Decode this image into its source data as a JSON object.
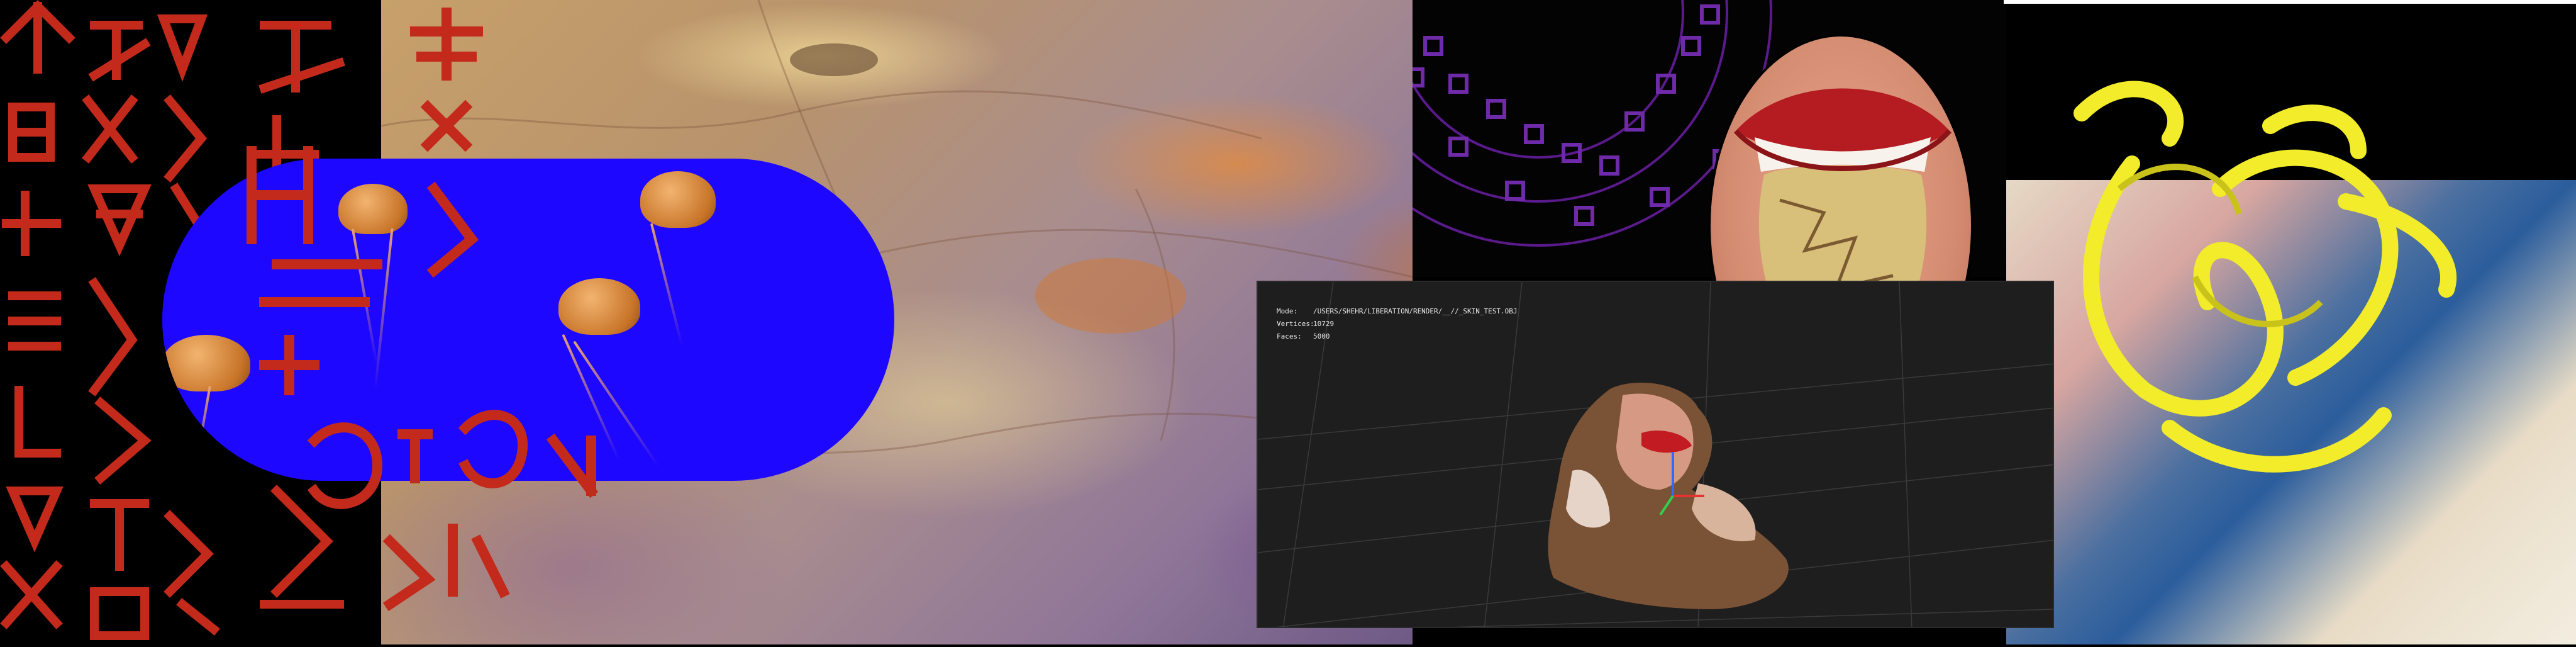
{
  "viewer": {
    "mode_label": "Mode:",
    "mode_value": "/USERS/SHEHR/LIBERATION/RENDER/__//_SKIN_TEST.OBJ",
    "vertices_label": "Vertices:",
    "vertices_value": "10729",
    "faces_label": "Faces:",
    "faces_value": "5000"
  },
  "colors": {
    "glyph_red": "#c42a1c",
    "pill_blue": "#1d07ff",
    "ribbon_yellow": "#f2ec2a",
    "ring_purple": "#5a1a8c",
    "viewer_bg": "#1e1e1e"
  },
  "icons": [
    "red-glyph-script",
    "jellyfish",
    "purple-circle-rings",
    "3d-head-model",
    "axis-gizmo",
    "open-mouth",
    "yellow-ribbons"
  ]
}
